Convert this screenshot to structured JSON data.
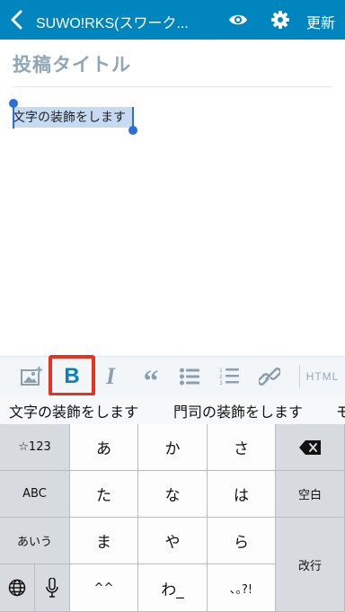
{
  "header": {
    "site_title": "SUWO!RKS(スワーク...",
    "update_label": "更新"
  },
  "editor": {
    "title_placeholder": "投稿タイトル",
    "selected_text": "文字の装飾をします"
  },
  "format_toolbar": {
    "bold_label": "B",
    "italic_label": "I",
    "quote_label": "“",
    "html_label": "HTML",
    "highlight_color": "#e8321f",
    "tools": [
      "image-icon",
      "bold",
      "italic",
      "blockquote",
      "unordered-list-icon",
      "ordered-list-icon",
      "link-icon",
      "html"
    ]
  },
  "predictions": [
    "文字の装飾をします",
    "門司の装飾をします",
    "モ"
  ],
  "keyboard": {
    "row1": [
      "☆123",
      "あ",
      "か",
      "さ"
    ],
    "row2": [
      "ABC",
      "た",
      "な",
      "は",
      "空白"
    ],
    "row3": [
      "あいう",
      "ま",
      "や",
      "ら",
      "改行"
    ],
    "row4": [
      "^^",
      "わ_",
      "､｡?!"
    ]
  },
  "colors": {
    "topbar": "#0085be",
    "selection": "#c6dbf2",
    "handles": "#2a6fdb"
  }
}
